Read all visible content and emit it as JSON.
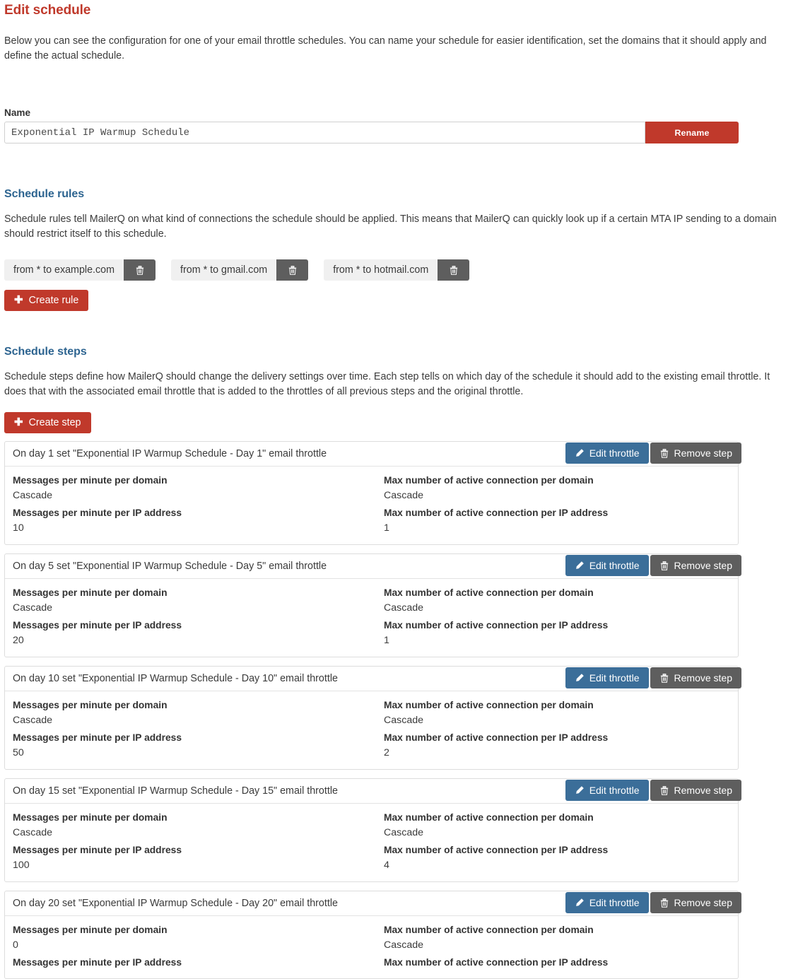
{
  "page": {
    "title": "Edit schedule",
    "intro": "Below you can see the configuration for one of your email throttle schedules. You can name your schedule for easier identification, set the domains that it should apply and define the actual schedule."
  },
  "name_section": {
    "label": "Name",
    "value": "Exponential IP Warmup Schedule",
    "placeholder": "Exponential IP Warmup Schedule",
    "rename_button": "Rename"
  },
  "rules_section": {
    "title": "Schedule rules",
    "intro": "Schedule rules tell MailerQ on what kind of connections the schedule should be applied. This means that MailerQ can quickly look up if a certain MTA IP sending to a domain should restrict itself to this schedule.",
    "rules": [
      {
        "label": "from * to example.com",
        "delete_icon": "trash-icon"
      },
      {
        "label": "from * to gmail.com",
        "delete_icon": "trash-icon"
      },
      {
        "label": "from * to hotmail.com",
        "delete_icon": "trash-icon"
      }
    ],
    "create_button": "Create rule",
    "create_icon": "plus-icon"
  },
  "steps_section": {
    "title": "Schedule steps",
    "intro": "Schedule steps define how MailerQ should change the delivery settings over time. Each step tells on which day of the schedule it should add to the existing email throttle. It does that with the associated email throttle that is added to the throttles of all previous steps and the original throttle.",
    "create_button": "Create step",
    "create_icon": "plus-icon",
    "edit_button": "Edit throttle",
    "edit_icon": "pencil-icon",
    "remove_button": "Remove step",
    "remove_icon": "trash-icon",
    "field_labels": {
      "messages_per_minute_per_domain": "Messages per minute per domain",
      "max_connections_per_domain": "Max number of active connection per domain",
      "messages_per_minute_per_ip": "Messages per minute per IP address",
      "max_connections_per_ip": "Max number of active connection per IP address"
    },
    "steps": [
      {
        "title": "On day 1 set \"Exponential IP Warmup Schedule - Day 1\" email throttle",
        "messages_per_minute_per_domain": "Cascade",
        "max_connections_per_domain": "Cascade",
        "messages_per_minute_per_ip": "10",
        "max_connections_per_ip": "1"
      },
      {
        "title": "On day 5 set \"Exponential IP Warmup Schedule - Day 5\" email throttle",
        "messages_per_minute_per_domain": "Cascade",
        "max_connections_per_domain": "Cascade",
        "messages_per_minute_per_ip": "20",
        "max_connections_per_ip": "1"
      },
      {
        "title": "On day 10 set \"Exponential IP Warmup Schedule - Day 10\" email throttle",
        "messages_per_minute_per_domain": "Cascade",
        "max_connections_per_domain": "Cascade",
        "messages_per_minute_per_ip": "50",
        "max_connections_per_ip": "2"
      },
      {
        "title": "On day 15 set \"Exponential IP Warmup Schedule - Day 15\" email throttle",
        "messages_per_minute_per_domain": "Cascade",
        "max_connections_per_domain": "Cascade",
        "messages_per_minute_per_ip": "100",
        "max_connections_per_ip": "4"
      },
      {
        "title": "On day 20 set \"Exponential IP Warmup Schedule - Day 20\" email throttle",
        "messages_per_minute_per_domain": "0",
        "max_connections_per_domain": "Cascade",
        "messages_per_minute_per_ip": "",
        "max_connections_per_ip": ""
      }
    ]
  },
  "colors": {
    "title_red": "#c0392b",
    "section_blue": "#2d6490",
    "edit_blue": "#3b6e99",
    "gray_button": "#5e5e5e",
    "chip_gray": "#f0f0f0"
  }
}
